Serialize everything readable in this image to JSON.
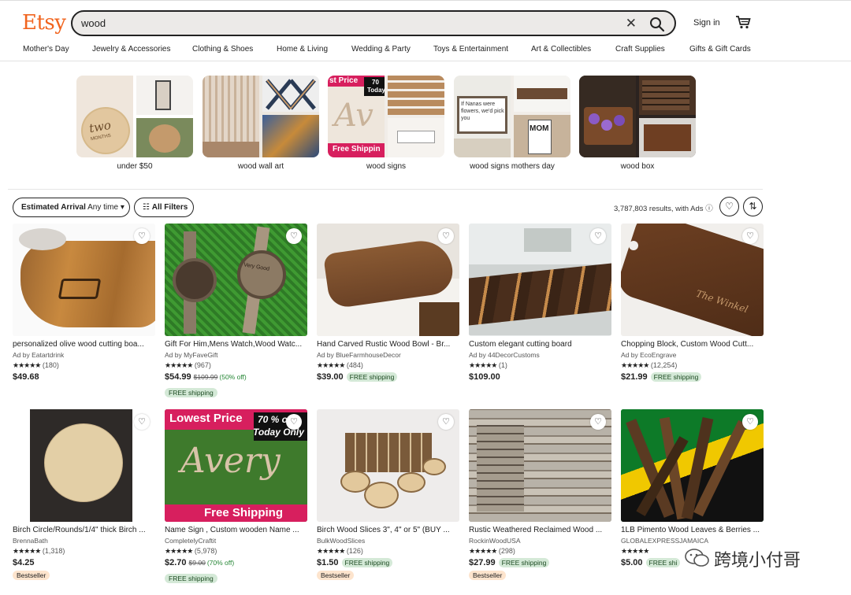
{
  "header": {
    "logo": "Etsy",
    "search_value": "wood",
    "signin": "Sign in"
  },
  "categories": [
    "Mother's Day",
    "Jewelry & Accessories",
    "Clothing & Shoes",
    "Home & Living",
    "Wedding & Party",
    "Toys & Entertainment",
    "Art & Collectibles",
    "Craft Supplies",
    "Gifts & Gift Cards"
  ],
  "suggestions": [
    {
      "label": "under $50"
    },
    {
      "label": "wood wall art"
    },
    {
      "label": "wood signs"
    },
    {
      "label": "wood signs mothers day"
    },
    {
      "label": "wood box"
    }
  ],
  "suggestion_text": {
    "s2": "st Price",
    "s2b": "70",
    "s2c": "Today",
    "s2d": "Free Shippin",
    "s0a": "two",
    "s0b": "MONTHS",
    "s3a": "If Nanas were flowers, we'd pick you",
    "s3b": "MOM"
  },
  "filters": {
    "arrival_label": "Estimated Arrival",
    "arrival_value": "Any time",
    "all_filters": "All Filters",
    "results": "3,787,803 results, with Ads"
  },
  "products": [
    {
      "title": "personalized olive wood cutting boa...",
      "seller": "Ad by Eatartdrink",
      "stars": "★★★★★",
      "count": "(180)",
      "price": "$49.68",
      "orig": "",
      "disc": "",
      "ship_inline": "",
      "ship_line": "",
      "best": ""
    },
    {
      "title": "Gift For Him,Mens Watch,Wood Watc...",
      "seller": "Ad by MyFaveGift",
      "stars": "★★★★★",
      "count": "(967)",
      "price": "$54.99",
      "orig": "$109.99",
      "disc": "(50% off)",
      "ship_inline": "",
      "ship_line": "FREE shipping",
      "best": ""
    },
    {
      "title": "Hand Carved Rustic Wood Bowl - Br...",
      "seller": "Ad by BlueFarmhouseDecor",
      "stars": "★★★★★",
      "count": "(484)",
      "price": "$39.00",
      "orig": "",
      "disc": "",
      "ship_inline": "FREE shipping",
      "ship_line": "",
      "best": ""
    },
    {
      "title": "Custom elegant cutting board",
      "seller": "Ad by 44DecorCustoms",
      "stars": "★★★★★",
      "count": "(1)",
      "price": "$109.00",
      "orig": "",
      "disc": "",
      "ship_inline": "",
      "ship_line": "",
      "best": ""
    },
    {
      "title": "Chopping Block, Custom Wood Cutt...",
      "seller": "Ad by EcoEngrave",
      "stars": "★★★★★",
      "count": "(12,254)",
      "price": "$21.99",
      "orig": "",
      "disc": "",
      "ship_inline": "FREE shipping",
      "ship_line": "",
      "best": ""
    },
    {
      "title": "Birch Circle/Rounds/1/4\" thick Birch ...",
      "seller": "BrennaBath",
      "stars": "★★★★★",
      "count": "(1,318)",
      "price": "$4.25",
      "orig": "",
      "disc": "",
      "ship_inline": "",
      "ship_line": "",
      "best": "Bestseller"
    },
    {
      "title": "Name Sign , Custom wooden Name ...",
      "seller": "CompletelyCraftit",
      "stars": "★★★★★",
      "count": "(5,978)",
      "price": "$2.70",
      "orig": "$9.00",
      "disc": "(70% off)",
      "ship_inline": "",
      "ship_line": "FREE shipping",
      "best": ""
    },
    {
      "title": "Birch Wood Slices 3\", 4\" or 5\" (BUY ...",
      "seller": "BulkWoodSlices",
      "stars": "★★★★★",
      "count": "(126)",
      "price": "$1.50",
      "orig": "",
      "disc": "",
      "ship_inline": "FREE shipping",
      "ship_line": "",
      "best": "Bestseller"
    },
    {
      "title": "Rustic Weathered Reclaimed Wood ...",
      "seller": "RockinWoodUSA",
      "stars": "★★★★★",
      "count": "(298)",
      "price": "$27.99",
      "orig": "",
      "disc": "",
      "ship_inline": "FREE shipping",
      "ship_line": "",
      "best": "Bestseller"
    },
    {
      "title": "1LB Pimento Wood Leaves & Berries ...",
      "seller": "GLOBALEXPRESSJAMAICA",
      "stars": "★★★★★",
      "count": "(...)",
      "price": "$5.00",
      "orig": "",
      "disc": "",
      "ship_inline": "FREE shi",
      "ship_line": "",
      "best": ""
    }
  ],
  "product_text": {
    "p6a": "Lowest Price",
    "p6b": "70 % o",
    "p6c": "Today Only",
    "p6d": "Avery",
    "p6e": "Free Shipping",
    "p1a": "Very Good",
    "p4a": "The Winkel"
  },
  "watermark": "跨境小付哥",
  "colors": {
    "brand": "#f1641e",
    "free_shipping_bg": "#d4e9d7",
    "bestseller_bg": "#fde4cd",
    "sale_green": "#258635"
  }
}
